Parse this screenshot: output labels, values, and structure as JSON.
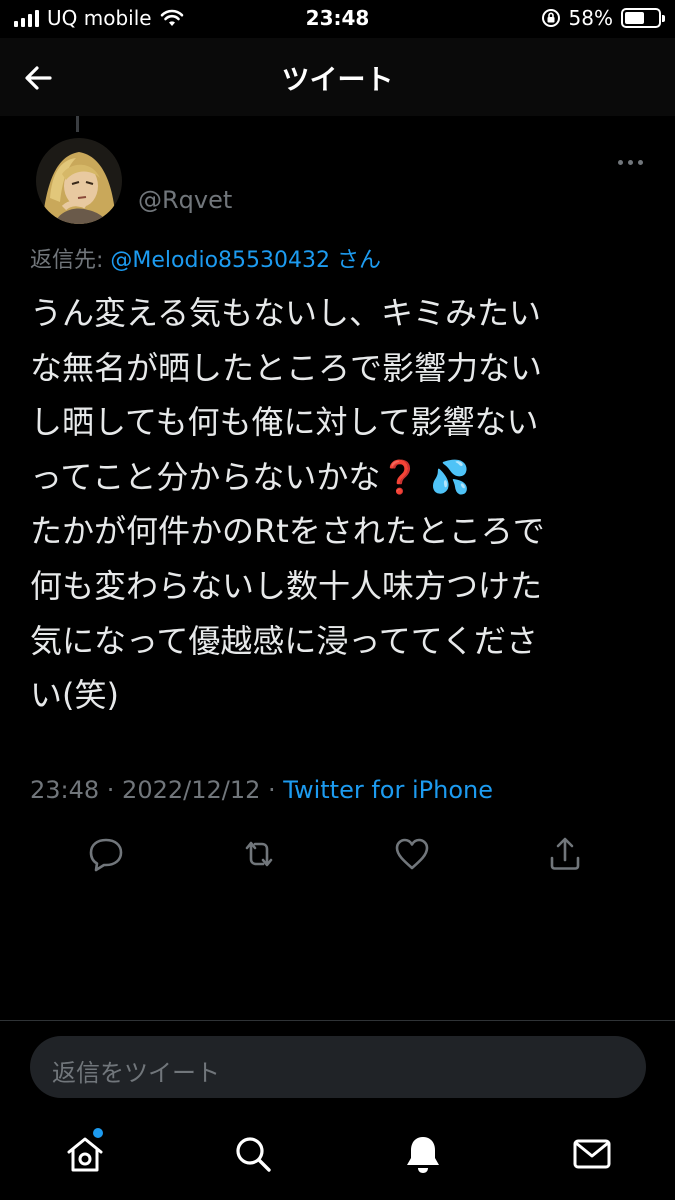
{
  "status_bar": {
    "carrier": "UQ mobile",
    "time": "23:48",
    "battery_percent": "58%",
    "battery_level": 0.58
  },
  "header": {
    "title": "ツイート"
  },
  "tweet": {
    "handle": "@Rqvet",
    "reply_prefix": "返信先: ",
    "reply_mention": "@Melodio85530432",
    "reply_suffix": " さん",
    "body_lines": [
      "うん変える気もないし、キミみたい",
      "な無名が晒したところで影響力ない",
      "し晒しても何も俺に対して影響ない",
      "ってこと分からないかな❓ 💦",
      "たかが何件かのRtをされたところで",
      "何も変わらないし数十人味方つけた",
      "気になって優越感に浸っててくださ",
      "い(笑)"
    ],
    "timestamp": "23:48 · 2022/12/12 · ",
    "source": "Twitter for iPhone"
  },
  "actions": {
    "icons": [
      "reply-icon",
      "retweet-icon",
      "like-icon",
      "share-icon"
    ]
  },
  "reply_box": {
    "placeholder": "返信をツイート"
  },
  "tab_bar": {
    "icons": [
      "home-icon",
      "search-icon",
      "notifications-icon",
      "messages-icon"
    ]
  },
  "colors": {
    "background": "#000000",
    "text": "#e7e9ea",
    "secondary": "#71767b",
    "accent": "#1d9bf0",
    "input_bg": "#202327"
  }
}
